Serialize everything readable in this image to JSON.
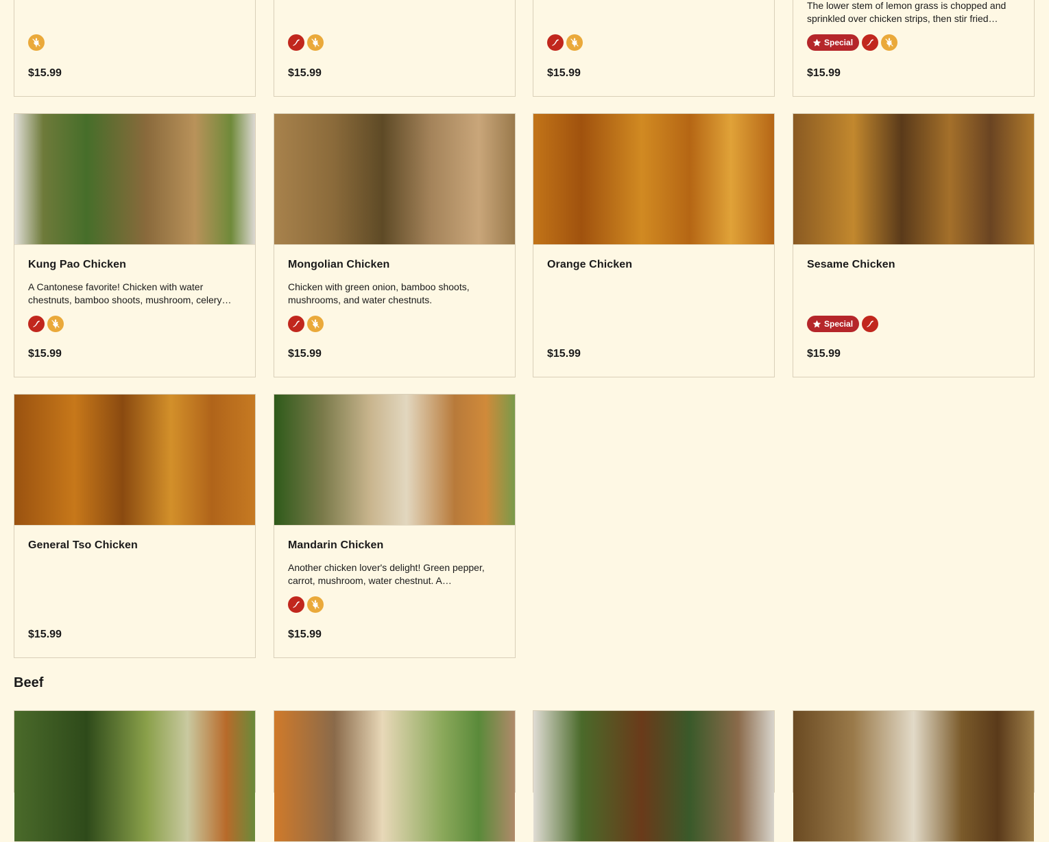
{
  "labels": {
    "special": "Special"
  },
  "colors": {
    "background": "#fef8e4",
    "spicy": "#c1271d",
    "gluten_free": "#eaa93a",
    "special": "#b5262a"
  },
  "top_row": [
    {
      "desc": "",
      "special": false,
      "spicy": false,
      "gf": true,
      "price": "$15.99"
    },
    {
      "desc": "",
      "special": false,
      "spicy": true,
      "gf": true,
      "price": "$15.99"
    },
    {
      "desc": "",
      "special": false,
      "spicy": true,
      "gf": true,
      "price": "$15.99"
    },
    {
      "desc": "The lower stem of lemon grass is chopped and sprinkled over chicken strips, then stir fried…",
      "special": true,
      "spicy": true,
      "gf": true,
      "price": "$15.99"
    }
  ],
  "chicken": [
    {
      "title": "Kung Pao Chicken",
      "desc": "A Cantonese favorite! Chicken with water chestnuts, bamboo shoots, mushroom, celery…",
      "special": false,
      "spicy": true,
      "gf": true,
      "price": "$15.99",
      "image": "food-photo"
    },
    {
      "title": "Mongolian Chicken",
      "desc": "Chicken with green onion, bamboo shoots, mushrooms, and water chestnuts.",
      "special": false,
      "spicy": true,
      "gf": true,
      "price": "$15.99",
      "image": "food-photo"
    },
    {
      "title": "Orange Chicken",
      "desc": "",
      "special": false,
      "spicy": false,
      "gf": false,
      "price": "$15.99",
      "image": "food-photo"
    },
    {
      "title": "Sesame Chicken",
      "desc": "",
      "special": true,
      "spicy": true,
      "gf": false,
      "price": "$15.99",
      "image": "food-photo"
    },
    {
      "title": "General Tso Chicken",
      "desc": "",
      "special": false,
      "spicy": false,
      "gf": false,
      "price": "$15.99",
      "image": "food-photo"
    },
    {
      "title": "Mandarin Chicken",
      "desc": "Another chicken lover's delight! Green pepper, carrot, mushroom, water chestnut. A…",
      "special": false,
      "spicy": true,
      "gf": true,
      "price": "$15.99",
      "image": "food-photo"
    }
  ],
  "beef": {
    "section_title": "Beef",
    "items": [
      {
        "image": "food-photo"
      },
      {
        "image": "food-photo"
      },
      {
        "image": "food-photo"
      },
      {
        "image": "food-photo"
      }
    ]
  }
}
